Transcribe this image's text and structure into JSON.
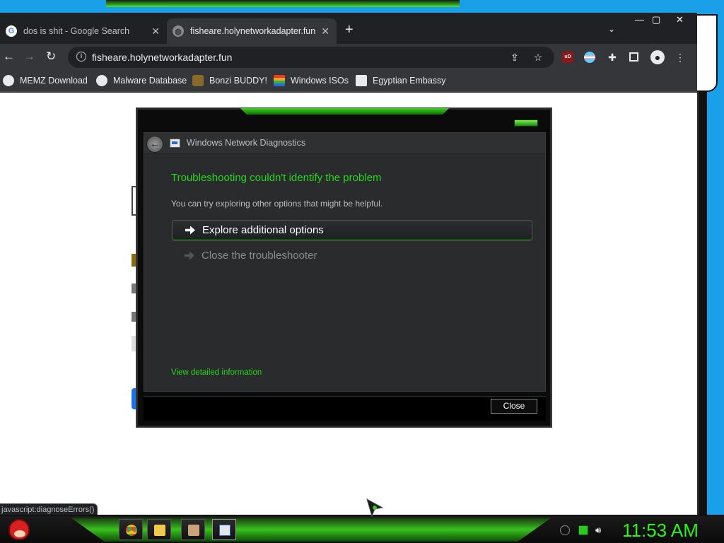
{
  "browser": {
    "tabs": [
      {
        "label": "dos is shit - Google Search",
        "favicon": "google-icon"
      },
      {
        "label": "fisheare.holynetworkadapter.fun",
        "favicon": "globe-icon"
      }
    ],
    "url": "fisheare.holynetworkadapter.fun",
    "bookmarks": [
      {
        "label": "MEMZ Download"
      },
      {
        "label": "Malware Database"
      },
      {
        "label": "Bonzi BUDDY!"
      },
      {
        "label": "Windows ISOs"
      },
      {
        "label": "Egyptian Embassy"
      }
    ],
    "status_text": "javascript:diagnoseErrors()",
    "extensions": {
      "ublock_badge": "uD"
    }
  },
  "dialog": {
    "title": "Windows Network Diagnostics",
    "heading": "Troubleshooting couldn't identify the problem",
    "subtext": "You can try exploring other options that might be helpful.",
    "options": [
      {
        "label": "Explore additional options"
      },
      {
        "label": "Close the troubleshooter"
      }
    ],
    "details_link": "View detailed information",
    "close_label": "Close",
    "accent_color": "#26d61a"
  },
  "taskbar": {
    "clock": "11:53 AM",
    "apps": [
      "chrome-icon",
      "file-explorer-icon",
      "wizard-icon",
      "network-diagnostics-icon"
    ],
    "tray": [
      "battery-icon",
      "network-icon",
      "volume-icon"
    ]
  }
}
